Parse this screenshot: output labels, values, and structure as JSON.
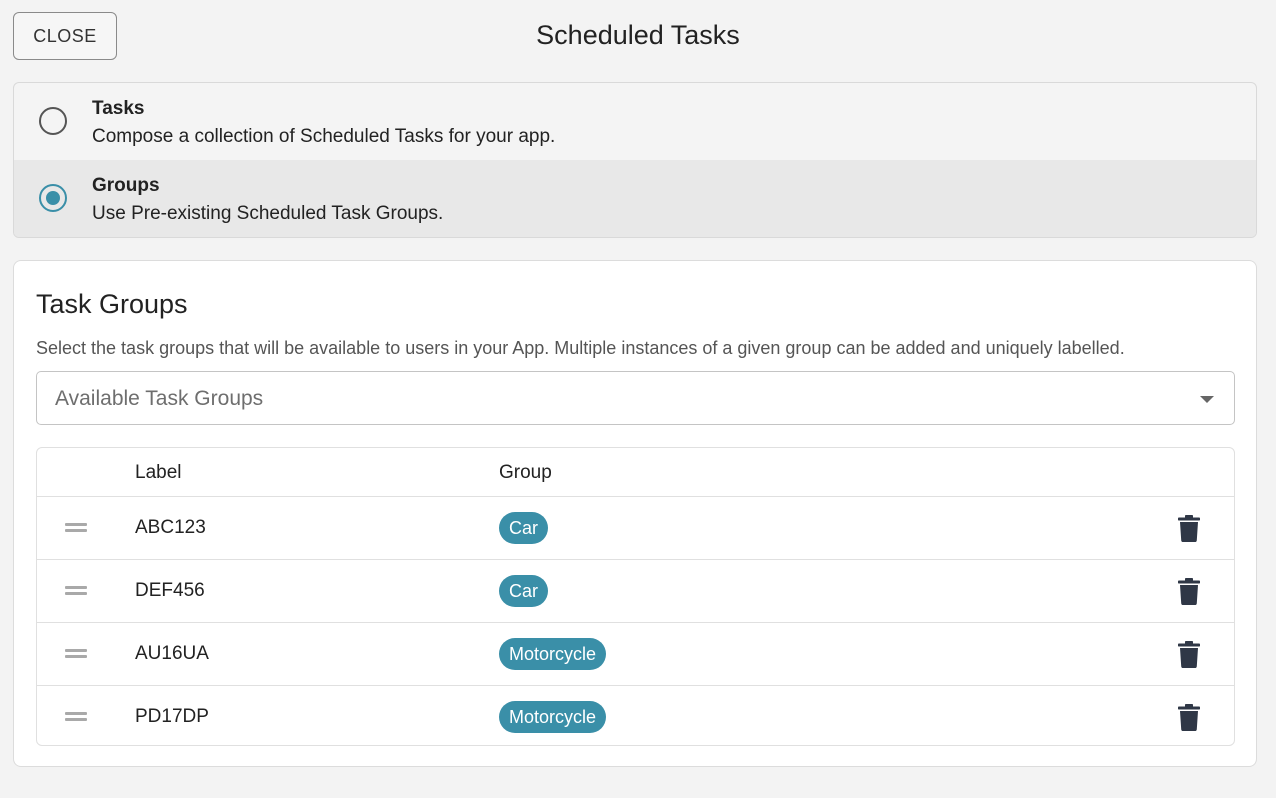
{
  "header": {
    "close_label": "CLOSE",
    "title": "Scheduled Tasks"
  },
  "modes": [
    {
      "title": "Tasks",
      "description": "Compose a collection of Scheduled Tasks for your app.",
      "selected": false
    },
    {
      "title": "Groups",
      "description": "Use Pre-existing Scheduled Task Groups.",
      "selected": true
    }
  ],
  "task_groups": {
    "title": "Task Groups",
    "description": "Select the task groups that will be available to users in your App. Multiple instances of a given group can be added and uniquely labelled.",
    "select_placeholder": "Available Task Groups",
    "columns": {
      "label": "Label",
      "group": "Group"
    },
    "rows": [
      {
        "label": "ABC123",
        "group": "Car"
      },
      {
        "label": "DEF456",
        "group": "Car"
      },
      {
        "label": "AU16UA",
        "group": "Motorcycle"
      },
      {
        "label": "PD17DP",
        "group": "Motorcycle"
      }
    ]
  },
  "icons": {
    "drag": "drag-handle-icon",
    "delete": "trash-icon",
    "dropdown": "caret-down-icon"
  },
  "colors": {
    "accent": "#3a8fa8",
    "chip_text": "#ffffff",
    "trash": "#2f3746"
  }
}
